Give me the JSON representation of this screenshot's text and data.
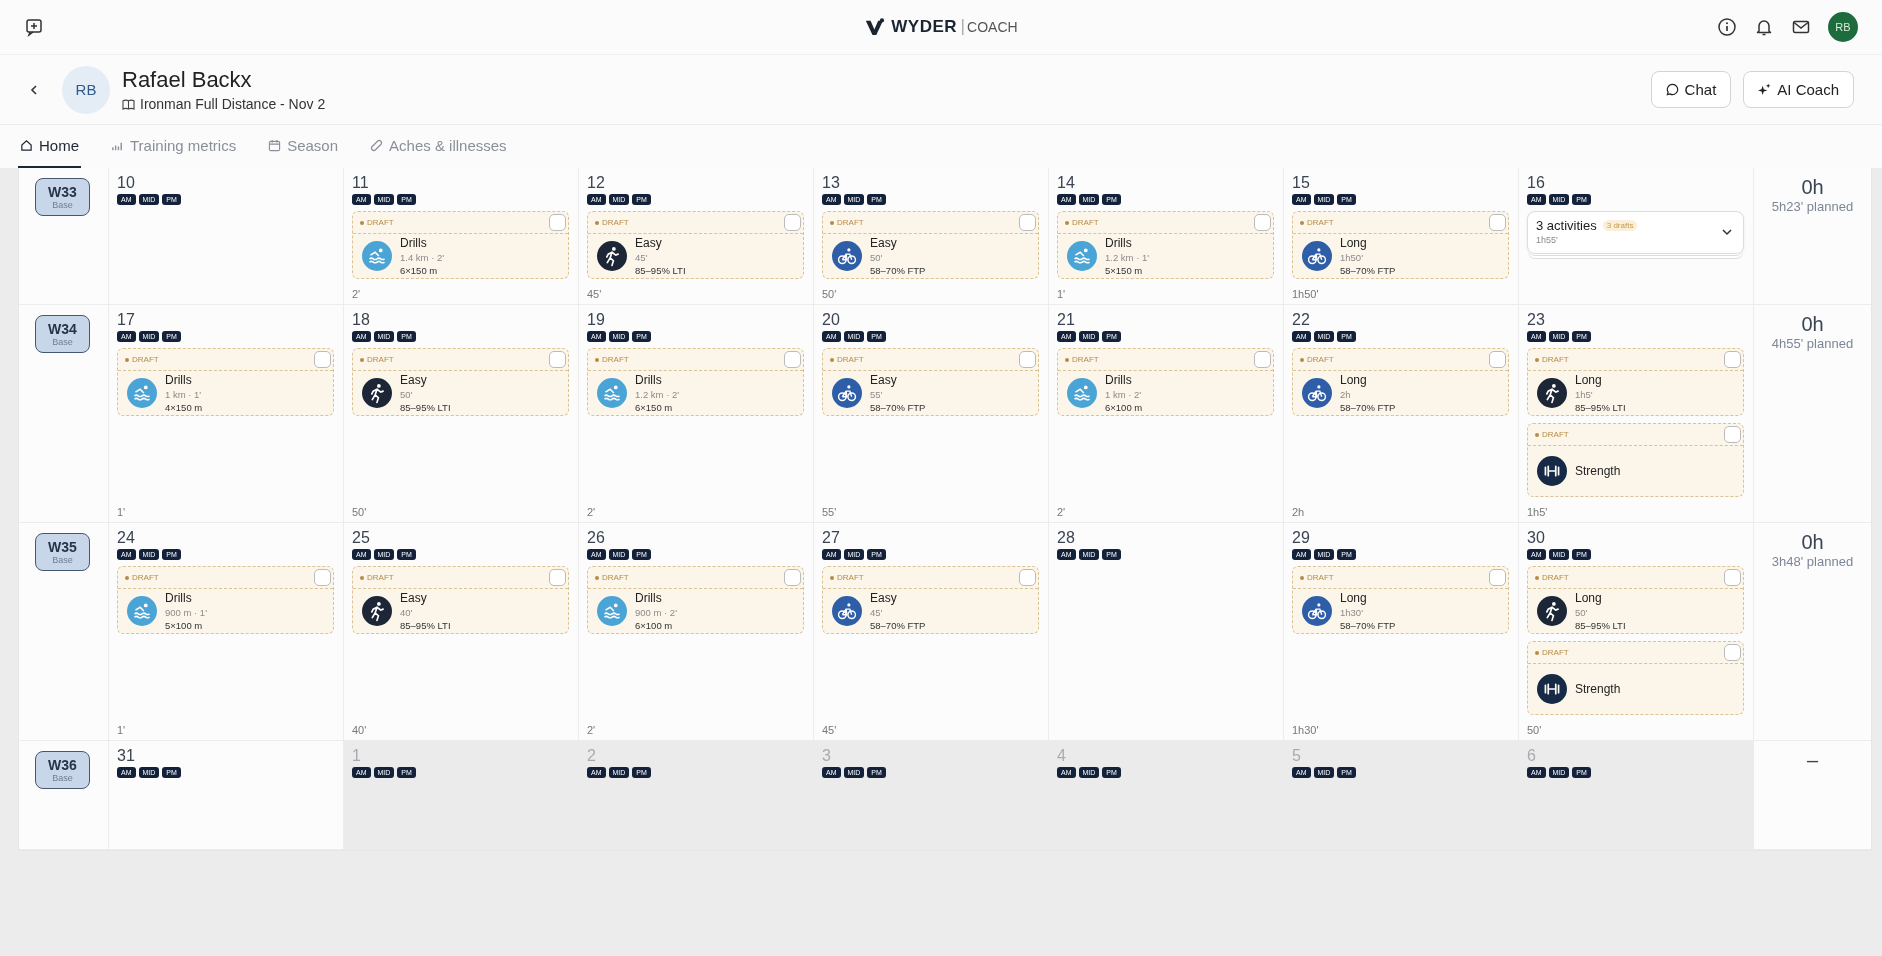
{
  "topbar": {
    "brand": "WYDER",
    "product": "COACH",
    "avatar": "RB"
  },
  "athlete": {
    "initials": "RB",
    "name": "Rafael Backx",
    "event": "Ironman Full Distance - Nov 2"
  },
  "actions": [
    {
      "kind": "chat",
      "label": "Chat"
    },
    {
      "kind": "ai",
      "label": "AI Coach"
    }
  ],
  "tabs": [
    {
      "kind": "home",
      "label": "Home",
      "selected": true
    },
    {
      "kind": "metrics",
      "label": "Training metrics",
      "selected": false
    },
    {
      "kind": "season",
      "label": "Season",
      "selected": false
    },
    {
      "kind": "aches",
      "label": "Aches & illnesses",
      "selected": false
    }
  ],
  "weeks": [
    {
      "label": "W33",
      "phase": "Base",
      "total": "0h",
      "planned": "5h23' planned",
      "days": [
        {
          "date": "10",
          "muted": false,
          "slots": [
            "AM",
            "MID",
            "PM"
          ]
        },
        {
          "date": "11",
          "muted": false,
          "slots": [
            "AM",
            "MID",
            "PM"
          ],
          "duration": "2'",
          "activities": [
            {
              "kind": "swim",
              "status": "DRAFT",
              "checked": false,
              "title": "Drills",
              "lines": [
                "1.4 km · 2'",
                "6×150 m"
              ]
            }
          ]
        },
        {
          "date": "12",
          "muted": false,
          "slots": [
            "AM",
            "MID",
            "PM"
          ],
          "duration": "45'",
          "activities": [
            {
              "kind": "run",
              "status": "DRAFT",
              "checked": false,
              "title": "Easy",
              "lines": [
                "45'",
                "85–95% LTI"
              ]
            }
          ]
        },
        {
          "date": "13",
          "muted": false,
          "slots": [
            "AM",
            "MID",
            "PM"
          ],
          "duration": "50'",
          "activities": [
            {
              "kind": "bike",
              "status": "DRAFT",
              "checked": false,
              "title": "Easy",
              "lines": [
                "50'",
                "58–70% FTP"
              ]
            }
          ]
        },
        {
          "date": "14",
          "muted": false,
          "slots": [
            "AM",
            "MID",
            "PM"
          ],
          "duration": "1'",
          "activities": [
            {
              "kind": "swim",
              "status": "DRAFT",
              "checked": false,
              "title": "Drills",
              "lines": [
                "1.2 km · 1'",
                "5×150 m"
              ]
            }
          ]
        },
        {
          "date": "15",
          "muted": false,
          "slots": [
            "AM",
            "MID",
            "PM"
          ],
          "duration": "1h50'",
          "activities": [
            {
              "kind": "bike",
              "status": "DRAFT",
              "checked": false,
              "title": "Long",
              "lines": [
                "1h50'",
                "58–70% FTP"
              ]
            }
          ]
        },
        {
          "date": "16",
          "muted": false,
          "slots": [
            "AM",
            "MID",
            "PM"
          ],
          "summary": {
            "count": "3 activities",
            "drafts": "3 drafts",
            "duration": "1h55'",
            "expanded": false
          }
        }
      ]
    },
    {
      "label": "W34",
      "phase": "Base",
      "total": "0h",
      "planned": "4h55' planned",
      "days": [
        {
          "date": "17",
          "muted": false,
          "slots": [
            "AM",
            "MID",
            "PM"
          ],
          "duration": "1'",
          "activities": [
            {
              "kind": "swim",
              "status": "DRAFT",
              "checked": false,
              "title": "Drills",
              "lines": [
                "1 km · 1'",
                "4×150 m"
              ]
            }
          ]
        },
        {
          "date": "18",
          "muted": false,
          "slots": [
            "AM",
            "MID",
            "PM"
          ],
          "duration": "50'",
          "activities": [
            {
              "kind": "run",
              "status": "DRAFT",
              "checked": false,
              "title": "Easy",
              "lines": [
                "50'",
                "85–95% LTI"
              ]
            }
          ]
        },
        {
          "date": "19",
          "muted": false,
          "slots": [
            "AM",
            "MID",
            "PM"
          ],
          "duration": "2'",
          "activities": [
            {
              "kind": "swim",
              "status": "DRAFT",
              "checked": false,
              "title": "Drills",
              "lines": [
                "1.2 km · 2'",
                "6×150 m"
              ]
            }
          ]
        },
        {
          "date": "20",
          "muted": false,
          "slots": [
            "AM",
            "MID",
            "PM"
          ],
          "duration": "55'",
          "activities": [
            {
              "kind": "bike",
              "status": "DRAFT",
              "checked": false,
              "title": "Easy",
              "lines": [
                "55'",
                "58–70% FTP"
              ]
            }
          ]
        },
        {
          "date": "21",
          "muted": false,
          "slots": [
            "AM",
            "MID",
            "PM"
          ],
          "duration": "2'",
          "activities": [
            {
              "kind": "swim",
              "status": "DRAFT",
              "checked": false,
              "title": "Drills",
              "lines": [
                "1 km · 2'",
                "6×100 m"
              ]
            }
          ]
        },
        {
          "date": "22",
          "muted": false,
          "slots": [
            "AM",
            "MID",
            "PM"
          ],
          "duration": "2h",
          "activities": [
            {
              "kind": "bike",
              "status": "DRAFT",
              "checked": false,
              "title": "Long",
              "lines": [
                "2h",
                "58–70% FTP"
              ]
            }
          ]
        },
        {
          "date": "23",
          "muted": false,
          "slots": [
            "AM",
            "MID",
            "PM"
          ],
          "duration": "1h5'",
          "activities": [
            {
              "kind": "run",
              "status": "DRAFT",
              "checked": false,
              "title": "Long",
              "lines": [
                "1h5'",
                "85–95% LTI"
              ]
            },
            {
              "kind": "strength",
              "status": "DRAFT",
              "checked": false,
              "title": "Strength"
            }
          ]
        }
      ]
    },
    {
      "label": "W35",
      "phase": "Base",
      "total": "0h",
      "planned": "3h48' planned",
      "days": [
        {
          "date": "24",
          "muted": false,
          "slots": [
            "AM",
            "MID",
            "PM"
          ],
          "duration": "1'",
          "activities": [
            {
              "kind": "swim",
              "status": "DRAFT",
              "checked": false,
              "title": "Drills",
              "lines": [
                "900 m · 1'",
                "5×100 m"
              ]
            }
          ]
        },
        {
          "date": "25",
          "muted": false,
          "slots": [
            "AM",
            "MID",
            "PM"
          ],
          "duration": "40'",
          "activities": [
            {
              "kind": "run",
              "status": "DRAFT",
              "checked": false,
              "title": "Easy",
              "lines": [
                "40'",
                "85–95% LTI"
              ]
            }
          ]
        },
        {
          "date": "26",
          "muted": false,
          "slots": [
            "AM",
            "MID",
            "PM"
          ],
          "duration": "2'",
          "activities": [
            {
              "kind": "swim",
              "status": "DRAFT",
              "checked": false,
              "title": "Drills",
              "lines": [
                "900 m · 2'",
                "6×100 m"
              ]
            }
          ]
        },
        {
          "date": "27",
          "muted": false,
          "slots": [
            "AM",
            "MID",
            "PM"
          ],
          "duration": "45'",
          "activities": [
            {
              "kind": "bike",
              "status": "DRAFT",
              "checked": false,
              "title": "Easy",
              "lines": [
                "45'",
                "58–70% FTP"
              ]
            }
          ]
        },
        {
          "date": "28",
          "muted": false,
          "slots": [
            "AM",
            "MID",
            "PM"
          ]
        },
        {
          "date": "29",
          "muted": false,
          "slots": [
            "AM",
            "MID",
            "PM"
          ],
          "duration": "1h30'",
          "activities": [
            {
              "kind": "bike",
              "status": "DRAFT",
              "checked": false,
              "title": "Long",
              "lines": [
                "1h30'",
                "58–70% FTP"
              ]
            }
          ]
        },
        {
          "date": "30",
          "muted": false,
          "slots": [
            "AM",
            "MID",
            "PM"
          ],
          "duration": "50'",
          "activities": [
            {
              "kind": "run",
              "status": "DRAFT",
              "checked": false,
              "title": "Long",
              "lines": [
                "50'",
                "85–95% LTI"
              ]
            },
            {
              "kind": "strength",
              "status": "DRAFT",
              "checked": false,
              "title": "Strength"
            }
          ]
        }
      ]
    },
    {
      "label": "W36",
      "phase": "Base",
      "total": "–",
      "days": [
        {
          "date": "31",
          "muted": false,
          "slots": [
            "AM",
            "MID",
            "PM"
          ]
        },
        {
          "date": "1",
          "muted": true,
          "slots": [
            "AM",
            "MID",
            "PM"
          ]
        },
        {
          "date": "2",
          "muted": true,
          "slots": [
            "AM",
            "MID",
            "PM"
          ]
        },
        {
          "date": "3",
          "muted": true,
          "slots": [
            "AM",
            "MID",
            "PM"
          ]
        },
        {
          "date": "4",
          "muted": true,
          "slots": [
            "AM",
            "MID",
            "PM"
          ]
        },
        {
          "date": "5",
          "muted": true,
          "slots": [
            "AM",
            "MID",
            "PM"
          ]
        },
        {
          "date": "6",
          "muted": true,
          "slots": [
            "AM",
            "MID",
            "PM"
          ]
        }
      ]
    }
  ]
}
